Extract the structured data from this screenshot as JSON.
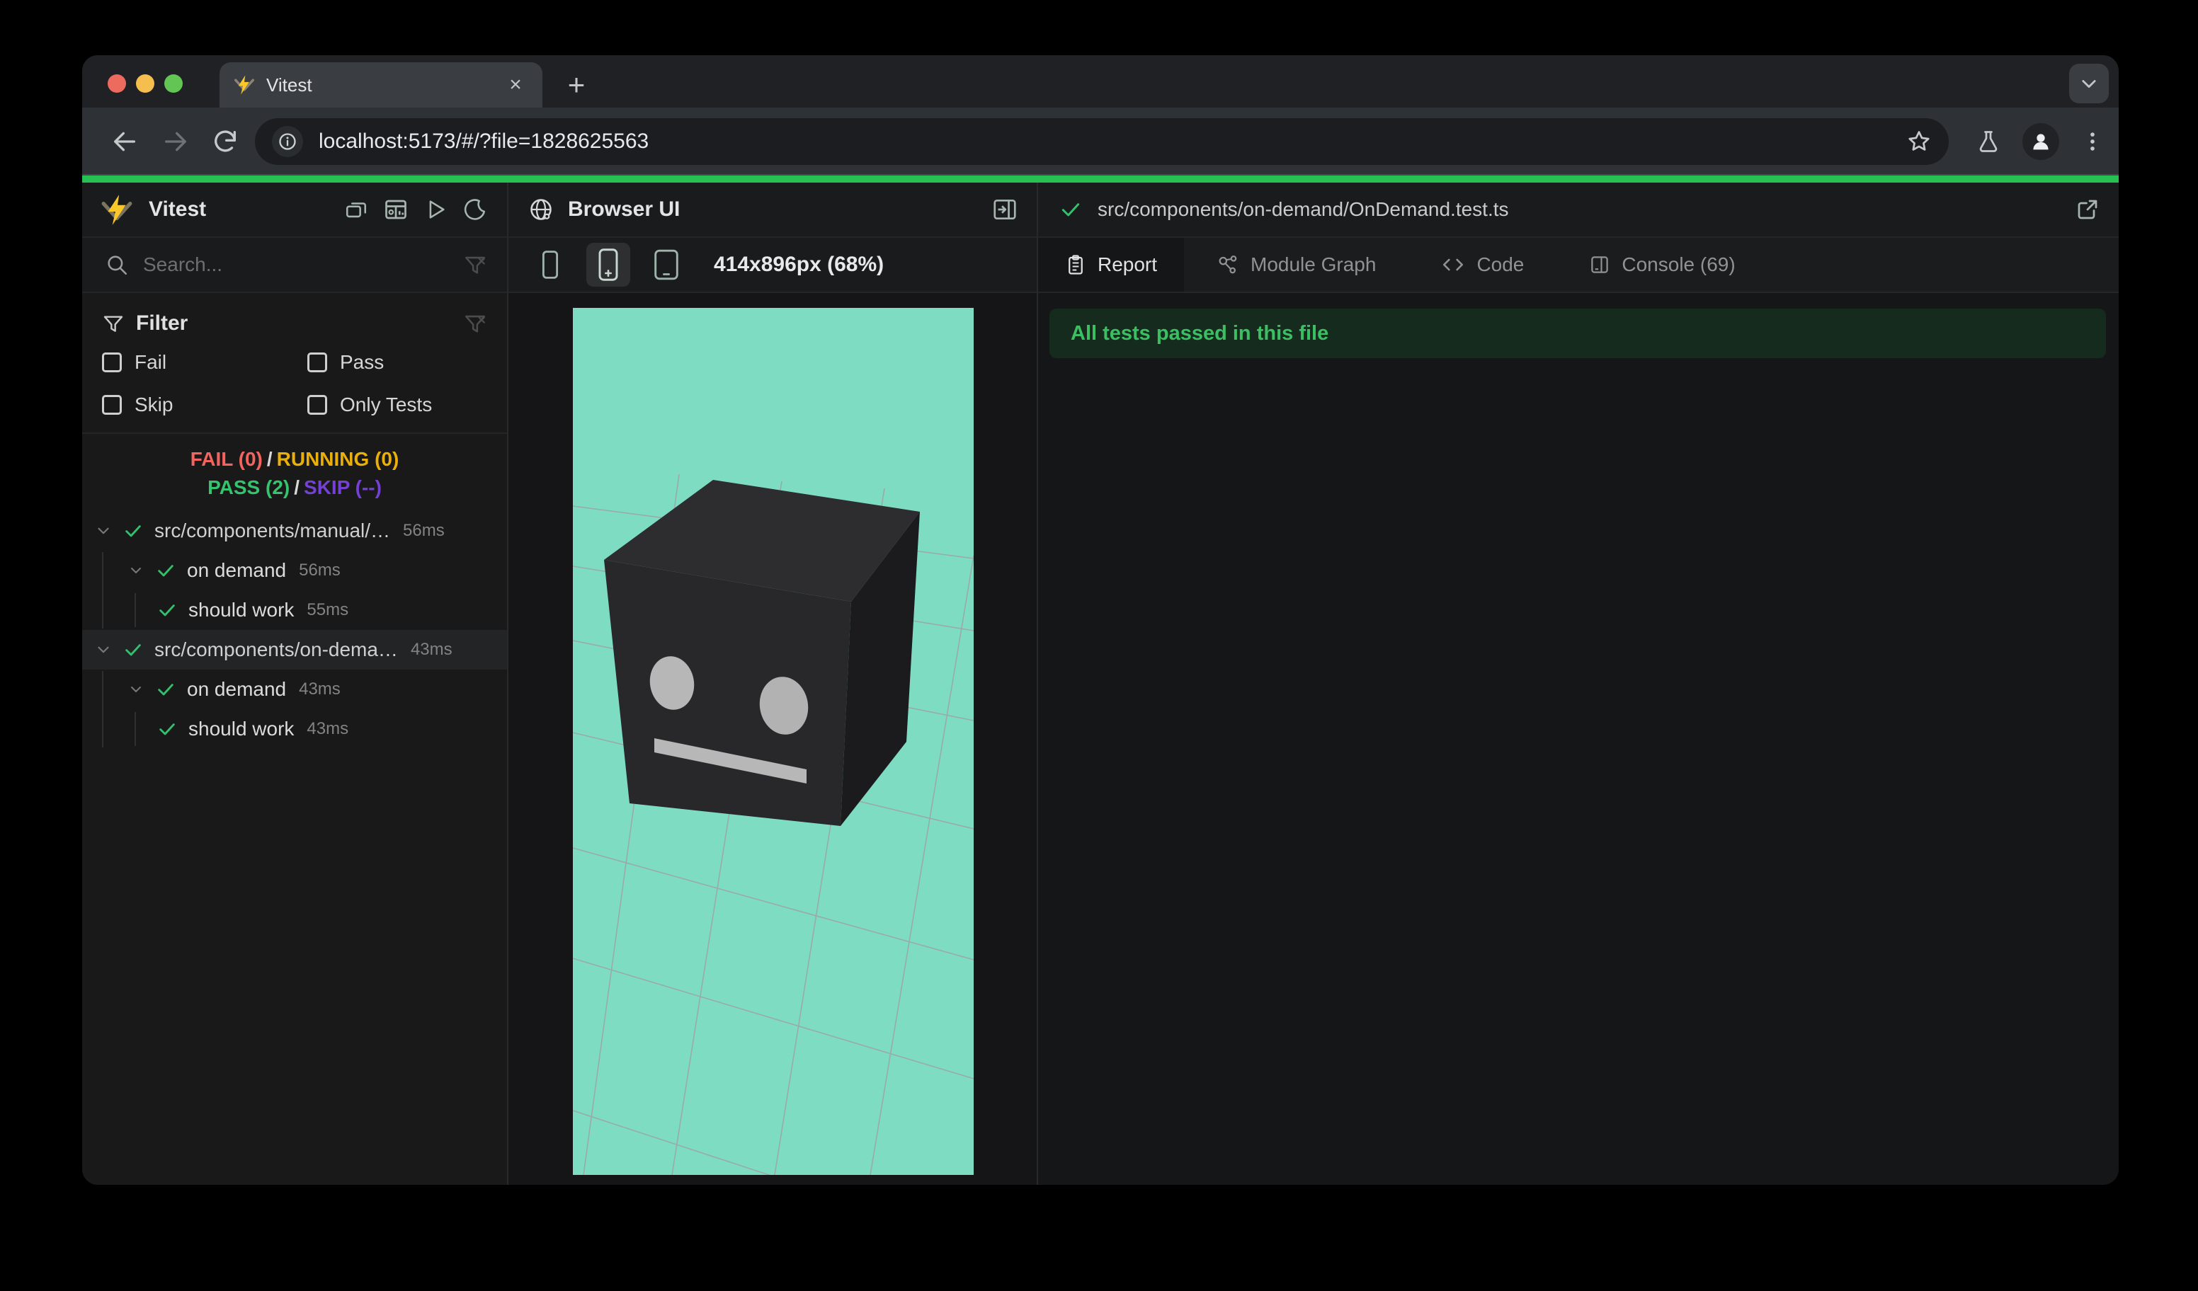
{
  "browser": {
    "tab": {
      "title": "Vitest",
      "close_glyph": "×"
    },
    "new_tab_glyph": "+",
    "toolbar": {
      "url": "localhost:5173/#/?file=1828625563"
    },
    "traffic_light_colors": [
      "#EC6A5E",
      "#F5BF4F",
      "#62C554"
    ]
  },
  "accent_color": "#27C053",
  "sidebar": {
    "title": "Vitest",
    "search": {
      "placeholder": "Search..."
    },
    "filter": {
      "title": "Filter",
      "options": [
        {
          "label": "Fail",
          "checked": false
        },
        {
          "label": "Pass",
          "checked": false
        },
        {
          "label": "Skip",
          "checked": false
        },
        {
          "label": "Only Tests",
          "checked": false
        }
      ]
    },
    "status": {
      "fail": "FAIL (0)",
      "running": "RUNNING (0)",
      "pass": "PASS (2)",
      "skip": "SKIP (--)",
      "sep": "/",
      "colors": {
        "fail": "#F3645E",
        "running": "#E9AF0B",
        "pass": "#35C46D",
        "skip": "#7440D6"
      }
    },
    "tree": [
      {
        "label": "src/components/manual/…",
        "duration": "56ms",
        "depth": 0,
        "status": "pass",
        "selected": false
      },
      {
        "label": "on demand",
        "duration": "56ms",
        "depth": 1,
        "status": "pass",
        "selected": false
      },
      {
        "label": "should work",
        "duration": "55ms",
        "depth": 2,
        "status": "pass",
        "selected": false
      },
      {
        "label": "src/components/on-dema…",
        "duration": "43ms",
        "depth": 0,
        "status": "pass",
        "selected": true
      },
      {
        "label": "on demand",
        "duration": "43ms",
        "depth": 1,
        "status": "pass",
        "selected": false
      },
      {
        "label": "should work",
        "duration": "43ms",
        "depth": 2,
        "status": "pass",
        "selected": false
      }
    ]
  },
  "browser_panel": {
    "title": "Browser UI",
    "viewport_label": "414x896px (68%)",
    "scene": {
      "description": "3D robot-head cube on grid floor",
      "background": "#7EDCC2",
      "cube_top": "#2D2D2F",
      "cube_front": "#28282A",
      "cube_right": "#1B1B1D",
      "face_features": "#B7B7B7",
      "grid_line": "#A39BA0"
    }
  },
  "report_panel": {
    "file_path": "src/components/on-demand/OnDemand.test.ts",
    "tabs": [
      {
        "label": "Report",
        "active": true
      },
      {
        "label": "Module Graph",
        "active": false
      },
      {
        "label": "Code",
        "active": false
      },
      {
        "label": "Console (69)",
        "active": false
      }
    ],
    "banner": {
      "text": "All tests passed in this file",
      "text_color": "#3CBF63",
      "background": "#152B1E"
    }
  }
}
